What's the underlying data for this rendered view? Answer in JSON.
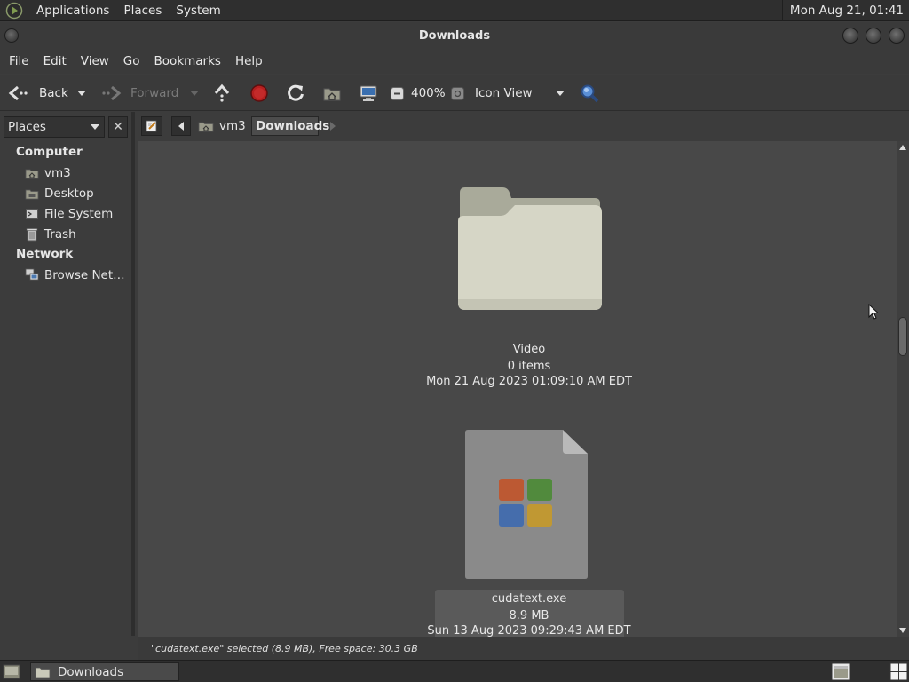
{
  "top_panel": {
    "menus": [
      "Applications",
      "Places",
      "System"
    ],
    "clock": "Mon Aug 21, 01:41"
  },
  "window": {
    "title": "Downloads"
  },
  "menubar": [
    "File",
    "Edit",
    "View",
    "Go",
    "Bookmarks",
    "Help"
  ],
  "toolbar": {
    "back": "Back",
    "forward": "Forward",
    "zoom": "400%",
    "view_mode": "Icon View"
  },
  "sidebar": {
    "selector": "Places",
    "computer_header": "Computer",
    "computer_items": [
      {
        "label": "vm3",
        "icon": "home-folder-icon"
      },
      {
        "label": "Desktop",
        "icon": "desktop-icon"
      },
      {
        "label": "File System",
        "icon": "drive-icon"
      },
      {
        "label": "Trash",
        "icon": "trash-icon"
      }
    ],
    "network_header": "Network",
    "network_items": [
      {
        "label": "Browse Net…",
        "icon": "network-icon"
      }
    ]
  },
  "location": {
    "crumbs": [
      "vm3",
      "Downloads"
    ]
  },
  "files": [
    {
      "name": "Video",
      "info": "0 items",
      "date": "Mon 21 Aug 2023 01:09:10 AM EDT",
      "icon": "folder-icon"
    },
    {
      "name": "cudatext.exe",
      "info": "8.9 MB",
      "date": "Sun 13 Aug 2023 09:29:43 AM EDT",
      "icon": "executable-icon"
    }
  ],
  "status": "\"cudatext.exe\" selected (8.9 MB), Free space: 30.3 GB",
  "taskbar": {
    "window": "Downloads"
  },
  "colors": {
    "background": "#484848",
    "panel": "#2f2f2f",
    "selection": "#5a5a5a"
  }
}
